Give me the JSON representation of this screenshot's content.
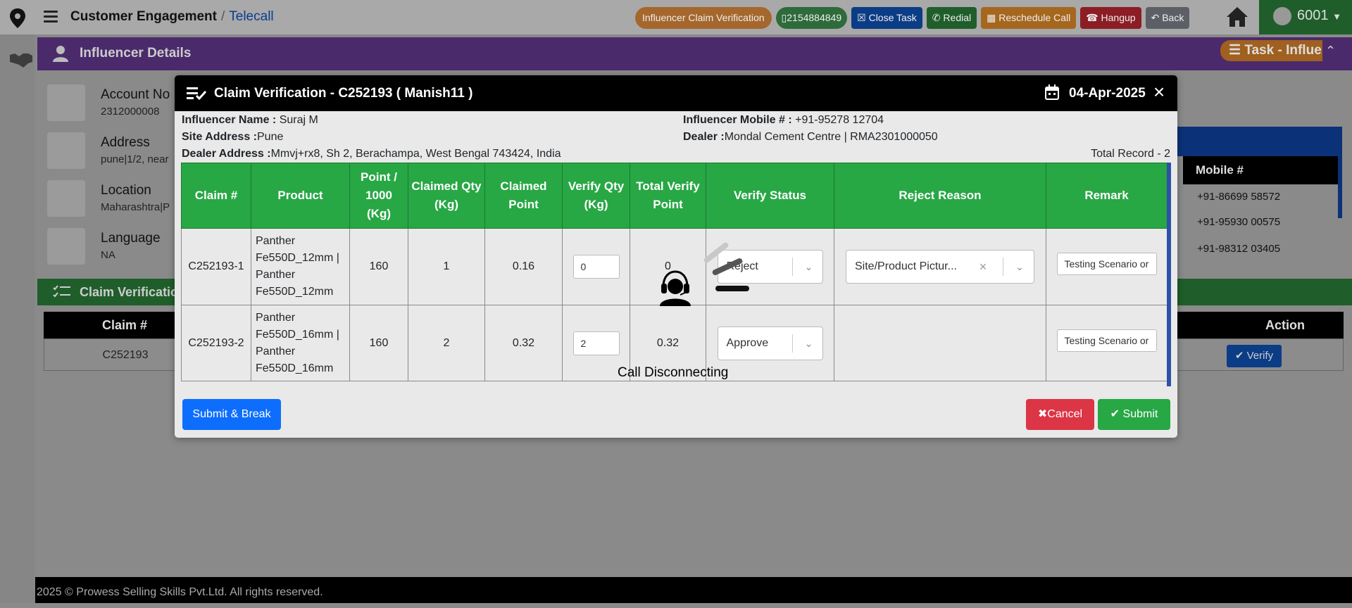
{
  "header": {
    "breadcrumb_main": "Customer Engagement",
    "breadcrumb_sep": "/",
    "breadcrumb_sub": "Telecall",
    "buttons": {
      "influencer_claim": "Influencer Claim Verification",
      "phone": "2154884849",
      "close_task": "Close Task",
      "redial": "Redial",
      "reschedule": "Reschedule Call",
      "hangup": "Hangup",
      "back": "Back"
    },
    "user": "6001"
  },
  "influencer_panel": {
    "title": "Influencer Details",
    "task_pill": "Task - Influe",
    "rows": [
      {
        "label": "Account No",
        "value": "2312000008"
      },
      {
        "label": "Address",
        "value": "pune|1/2, near"
      },
      {
        "label": "Location",
        "value": "Maharashtra|P"
      },
      {
        "label": "Language",
        "value": "NA"
      }
    ],
    "mobile_header": "Mobile #",
    "mobiles": [
      "+91-86699 58572",
      "+91-95930 00575",
      "+91-98312 03405"
    ]
  },
  "claim_panel": {
    "title": "Claim Verification",
    "col_claim": "Claim #",
    "col_action": "Action",
    "row_claim": "C252193",
    "verify_label": "Verify"
  },
  "footer": "2025 © Prowess Selling Skills Pvt.Ltd. All rights reserved.",
  "modal": {
    "title": "Claim Verification - C252193 ( Manish11 )",
    "date": "04-Apr-2025",
    "influencer_name_label": "Influencer Name :",
    "influencer_name": " Suraj M",
    "site_address_label": "Site Address :",
    "site_address": "Pune",
    "dealer_address_label": "Dealer Address :",
    "dealer_address": "Mmvj+rx8, Sh 2, Berachampa, West Bengal 743424, India",
    "influencer_mobile_label": "Influencer Mobile # :",
    "influencer_mobile": " +91-95278 12704",
    "dealer_label": "Dealer :",
    "dealer": "Mondal Cement Centre | RMA2301000050",
    "total_record": "Total Record - 2",
    "columns": [
      "Claim #",
      "Product",
      "Point / 1000 (Kg)",
      "Claimed Qty (Kg)",
      "Claimed Point",
      "Verify Qty (Kg)",
      "Total Verify Point",
      "Verify Status",
      "Reject Reason",
      "Remark"
    ],
    "rows": [
      {
        "claim": "C252193-1",
        "product": "Panther Fe550D_12mm | Panther Fe550D_12mm",
        "point": "160",
        "claimed_qty": "1",
        "claimed_point": "0.16",
        "verify_qty": "0",
        "total_verify": "0",
        "status": "Reject",
        "reject_reason": "Site/Product Pictur...",
        "remark": "Testing Scenario or"
      },
      {
        "claim": "C252193-2",
        "product": "Panther Fe550D_16mm | Panther Fe550D_16mm",
        "point": "160",
        "claimed_qty": "2",
        "claimed_point": "0.32",
        "verify_qty": "2",
        "total_verify": "0.32",
        "status": "Approve",
        "reject_reason": "",
        "remark": "Testing Scenario or"
      }
    ],
    "btn_submit_break": "Submit & Break",
    "btn_cancel": "Cancel",
    "btn_submit": "Submit"
  },
  "overlay": {
    "call_status": "Call Disconnecting"
  }
}
